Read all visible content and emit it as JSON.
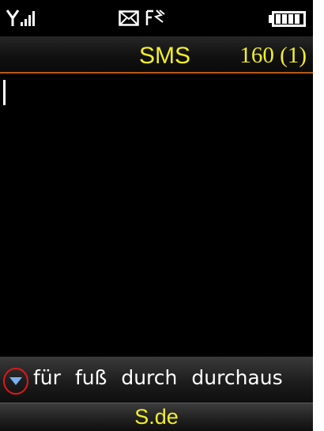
{
  "status_bar": {
    "icons": [
      "signal-icon",
      "envelope-icon",
      "fax-icon",
      "battery-icon"
    ],
    "battery_level": 1.0
  },
  "header": {
    "title": "SMS",
    "counter": "160 (1)"
  },
  "message": {
    "text": ""
  },
  "candidates": {
    "items": [
      "für",
      "fuß",
      "durch",
      "durchaus"
    ]
  },
  "softkeys": {
    "center_label": "S.de"
  },
  "colors": {
    "accent_text": "#f2ee2a",
    "divider": "#b85a1a",
    "cursor": "#ffffff"
  }
}
